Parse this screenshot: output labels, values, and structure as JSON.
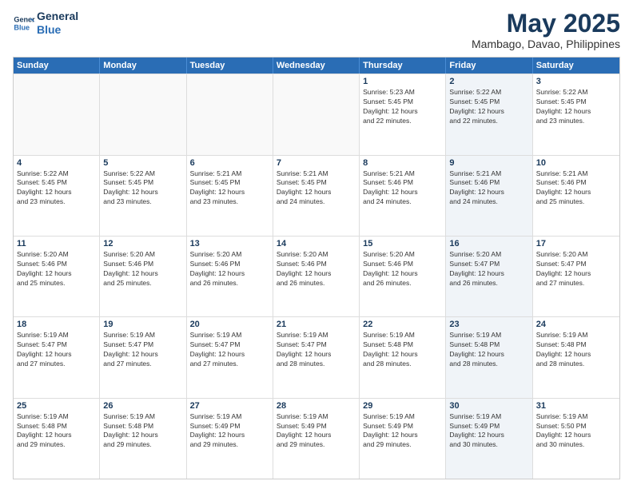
{
  "logo": {
    "line1": "General",
    "line2": "Blue"
  },
  "title": "May 2025",
  "subtitle": "Mambago, Davao, Philippines",
  "weekdays": [
    "Sunday",
    "Monday",
    "Tuesday",
    "Wednesday",
    "Thursday",
    "Friday",
    "Saturday"
  ],
  "rows": [
    [
      {
        "day": "",
        "info": "",
        "shaded": false,
        "empty": true
      },
      {
        "day": "",
        "info": "",
        "shaded": false,
        "empty": true
      },
      {
        "day": "",
        "info": "",
        "shaded": false,
        "empty": true
      },
      {
        "day": "",
        "info": "",
        "shaded": false,
        "empty": true
      },
      {
        "day": "1",
        "info": "Sunrise: 5:23 AM\nSunset: 5:45 PM\nDaylight: 12 hours\nand 22 minutes.",
        "shaded": false
      },
      {
        "day": "2",
        "info": "Sunrise: 5:22 AM\nSunset: 5:45 PM\nDaylight: 12 hours\nand 22 minutes.",
        "shaded": true
      },
      {
        "day": "3",
        "info": "Sunrise: 5:22 AM\nSunset: 5:45 PM\nDaylight: 12 hours\nand 23 minutes.",
        "shaded": false
      }
    ],
    [
      {
        "day": "4",
        "info": "Sunrise: 5:22 AM\nSunset: 5:45 PM\nDaylight: 12 hours\nand 23 minutes.",
        "shaded": false
      },
      {
        "day": "5",
        "info": "Sunrise: 5:22 AM\nSunset: 5:45 PM\nDaylight: 12 hours\nand 23 minutes.",
        "shaded": false
      },
      {
        "day": "6",
        "info": "Sunrise: 5:21 AM\nSunset: 5:45 PM\nDaylight: 12 hours\nand 23 minutes.",
        "shaded": false
      },
      {
        "day": "7",
        "info": "Sunrise: 5:21 AM\nSunset: 5:45 PM\nDaylight: 12 hours\nand 24 minutes.",
        "shaded": false
      },
      {
        "day": "8",
        "info": "Sunrise: 5:21 AM\nSunset: 5:46 PM\nDaylight: 12 hours\nand 24 minutes.",
        "shaded": false
      },
      {
        "day": "9",
        "info": "Sunrise: 5:21 AM\nSunset: 5:46 PM\nDaylight: 12 hours\nand 24 minutes.",
        "shaded": true
      },
      {
        "day": "10",
        "info": "Sunrise: 5:21 AM\nSunset: 5:46 PM\nDaylight: 12 hours\nand 25 minutes.",
        "shaded": false
      }
    ],
    [
      {
        "day": "11",
        "info": "Sunrise: 5:20 AM\nSunset: 5:46 PM\nDaylight: 12 hours\nand 25 minutes.",
        "shaded": false
      },
      {
        "day": "12",
        "info": "Sunrise: 5:20 AM\nSunset: 5:46 PM\nDaylight: 12 hours\nand 25 minutes.",
        "shaded": false
      },
      {
        "day": "13",
        "info": "Sunrise: 5:20 AM\nSunset: 5:46 PM\nDaylight: 12 hours\nand 26 minutes.",
        "shaded": false
      },
      {
        "day": "14",
        "info": "Sunrise: 5:20 AM\nSunset: 5:46 PM\nDaylight: 12 hours\nand 26 minutes.",
        "shaded": false
      },
      {
        "day": "15",
        "info": "Sunrise: 5:20 AM\nSunset: 5:46 PM\nDaylight: 12 hours\nand 26 minutes.",
        "shaded": false
      },
      {
        "day": "16",
        "info": "Sunrise: 5:20 AM\nSunset: 5:47 PM\nDaylight: 12 hours\nand 26 minutes.",
        "shaded": true
      },
      {
        "day": "17",
        "info": "Sunrise: 5:20 AM\nSunset: 5:47 PM\nDaylight: 12 hours\nand 27 minutes.",
        "shaded": false
      }
    ],
    [
      {
        "day": "18",
        "info": "Sunrise: 5:19 AM\nSunset: 5:47 PM\nDaylight: 12 hours\nand 27 minutes.",
        "shaded": false
      },
      {
        "day": "19",
        "info": "Sunrise: 5:19 AM\nSunset: 5:47 PM\nDaylight: 12 hours\nand 27 minutes.",
        "shaded": false
      },
      {
        "day": "20",
        "info": "Sunrise: 5:19 AM\nSunset: 5:47 PM\nDaylight: 12 hours\nand 27 minutes.",
        "shaded": false
      },
      {
        "day": "21",
        "info": "Sunrise: 5:19 AM\nSunset: 5:47 PM\nDaylight: 12 hours\nand 28 minutes.",
        "shaded": false
      },
      {
        "day": "22",
        "info": "Sunrise: 5:19 AM\nSunset: 5:48 PM\nDaylight: 12 hours\nand 28 minutes.",
        "shaded": false
      },
      {
        "day": "23",
        "info": "Sunrise: 5:19 AM\nSunset: 5:48 PM\nDaylight: 12 hours\nand 28 minutes.",
        "shaded": true
      },
      {
        "day": "24",
        "info": "Sunrise: 5:19 AM\nSunset: 5:48 PM\nDaylight: 12 hours\nand 28 minutes.",
        "shaded": false
      }
    ],
    [
      {
        "day": "25",
        "info": "Sunrise: 5:19 AM\nSunset: 5:48 PM\nDaylight: 12 hours\nand 29 minutes.",
        "shaded": false
      },
      {
        "day": "26",
        "info": "Sunrise: 5:19 AM\nSunset: 5:48 PM\nDaylight: 12 hours\nand 29 minutes.",
        "shaded": false
      },
      {
        "day": "27",
        "info": "Sunrise: 5:19 AM\nSunset: 5:49 PM\nDaylight: 12 hours\nand 29 minutes.",
        "shaded": false
      },
      {
        "day": "28",
        "info": "Sunrise: 5:19 AM\nSunset: 5:49 PM\nDaylight: 12 hours\nand 29 minutes.",
        "shaded": false
      },
      {
        "day": "29",
        "info": "Sunrise: 5:19 AM\nSunset: 5:49 PM\nDaylight: 12 hours\nand 29 minutes.",
        "shaded": false
      },
      {
        "day": "30",
        "info": "Sunrise: 5:19 AM\nSunset: 5:49 PM\nDaylight: 12 hours\nand 30 minutes.",
        "shaded": true
      },
      {
        "day": "31",
        "info": "Sunrise: 5:19 AM\nSunset: 5:50 PM\nDaylight: 12 hours\nand 30 minutes.",
        "shaded": false
      }
    ]
  ]
}
